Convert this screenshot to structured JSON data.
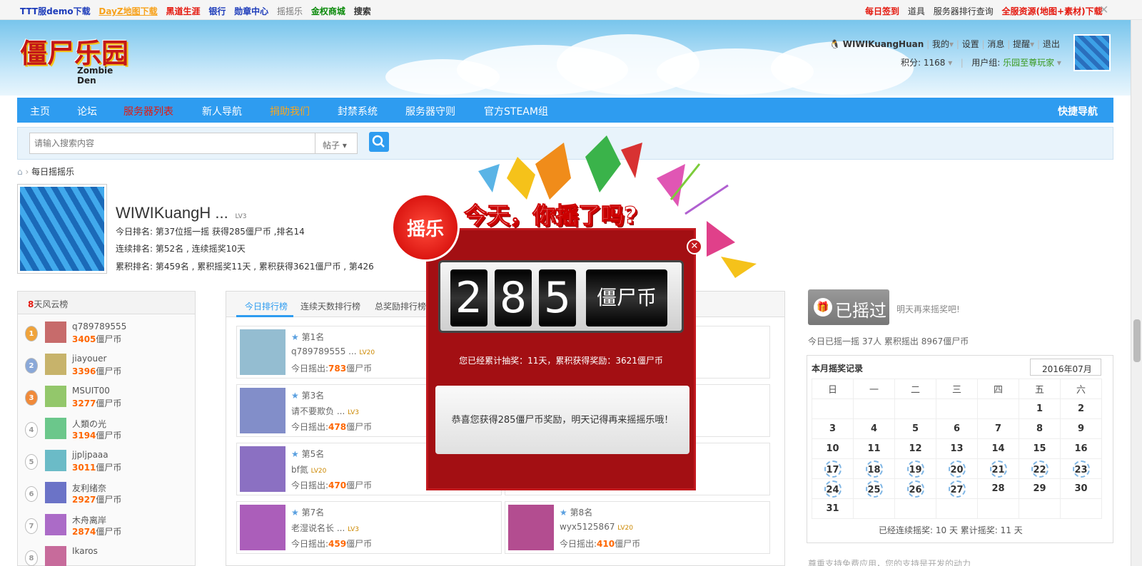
{
  "topbar": {
    "left": [
      "TTT服demo下载",
      "DayZ地图下载",
      "黑道生涯",
      "银行",
      "勋章中心",
      "摇摇乐",
      "金权商城",
      "搜索"
    ],
    "right": [
      "每日签到",
      "道具",
      "服务器排行查询",
      "全服资源(地图+素材)下载"
    ]
  },
  "logo": {
    "main": "僵尸乐园",
    "sub": "Zombie Den"
  },
  "user": {
    "name": "WIWIKuangHuan",
    "links": [
      "我的",
      "设置",
      "消息",
      "提醒",
      "退出"
    ],
    "points": "积分: 1168",
    "group_label": "用户组:",
    "group": "乐园至尊玩家"
  },
  "nav": {
    "items": [
      "主页",
      "论坛",
      "服务器列表",
      "新人导航",
      "捐助我们",
      "封禁系统",
      "服务器守则",
      "官方STEAM组"
    ],
    "quick": "快捷导航"
  },
  "search": {
    "placeholder": "请输入搜索内容",
    "type": "帖子"
  },
  "breadcrumb": "每日摇摇乐",
  "profile": {
    "name": "WIWIKuangH ...",
    "lv": "LV3",
    "line1": "今日排名: 第37位摇一摇 获得285僵尸币 ,排名14",
    "line2": "连续排名: 第52名 , 连续摇奖10天",
    "line3": "累积排名: 第459名 , 累积摇奖11天 , 累积获得3621僵尸币 , 第426"
  },
  "leaderboard": {
    "title_num": "8",
    "title": "天风云榜",
    "items": [
      {
        "rank": "1",
        "name": "q789789555",
        "coins": "3405",
        "unit": "僵尸币"
      },
      {
        "rank": "2",
        "name": "jiayouer",
        "coins": "3396",
        "unit": "僵尸币"
      },
      {
        "rank": "3",
        "name": "MSUIT00",
        "coins": "3277",
        "unit": "僵尸币"
      },
      {
        "rank": "4",
        "name": "人類の光",
        "coins": "3194",
        "unit": "僵尸币"
      },
      {
        "rank": "5",
        "name": "jjpljpaaa",
        "coins": "3011",
        "unit": "僵尸币"
      },
      {
        "rank": "6",
        "name": "友利绪奈",
        "coins": "2927",
        "unit": "僵尸币"
      },
      {
        "rank": "7",
        "name": "木舟离岸",
        "coins": "2874",
        "unit": "僵尸币"
      },
      {
        "rank": "8",
        "name": "Ikaros",
        "coins": "",
        "unit": ""
      }
    ]
  },
  "tabs": [
    "今日排行榜",
    "连续天数排行榜",
    "总奖励排行榜"
  ],
  "cards": [
    {
      "rank": "第1名",
      "name": "q789789555 ...",
      "lv": "LV20",
      "coins": "783",
      "label": "今日摇出:",
      "unit": "僵尸币"
    },
    {
      "rank": "第3名",
      "name": "请不要欺负 ...",
      "lv": "LV3",
      "coins": "478",
      "label": "今日摇出:",
      "unit": "僵尸币"
    },
    {
      "rank": "第5名",
      "name": "bf氮",
      "lv": "LV20",
      "coins": "470",
      "label": "今日摇出:",
      "unit": "僵尸币"
    },
    {
      "rank": "第7名",
      "name": "老湿说名长 ...",
      "lv": "LV3",
      "coins": "459",
      "label": "今日摇出:",
      "unit": "僵尸币"
    },
    {
      "rank": "第8名",
      "name": "wyx5125867",
      "lv": "LV20",
      "coins": "410",
      "label": "今日摇出:",
      "unit": "僵尸币"
    }
  ],
  "shake": {
    "done": "已摇过",
    "hint": "明天再来摇奖吧!",
    "stats": "今日已摇一摇 37人 累积摇出 8967僵尸币"
  },
  "calendar": {
    "title": "本月摇奖记录",
    "month": "2016年07月",
    "weekdays": [
      "日",
      "一",
      "二",
      "三",
      "四",
      "五",
      "六"
    ],
    "footer": "已经连续摇奖: 10 天 累计摇奖: 11 天"
  },
  "popup": {
    "badge": "摇乐",
    "slogan": "今天，你摇了吗?",
    "digits": [
      "2",
      "8",
      "5"
    ],
    "unit": "僵尸币",
    "summary": "您已经累计抽奖：11天，累积获得奖励：3621僵尸币",
    "message": "恭喜您获得285僵尸币奖励，明天记得再来摇摇乐哦！"
  },
  "bottom": "尊重支持免费应用，您的支持是开发的动力",
  "colors": {
    "nav": "#2e9cf0",
    "popup": "#a30f13",
    "accent": "#f60"
  }
}
